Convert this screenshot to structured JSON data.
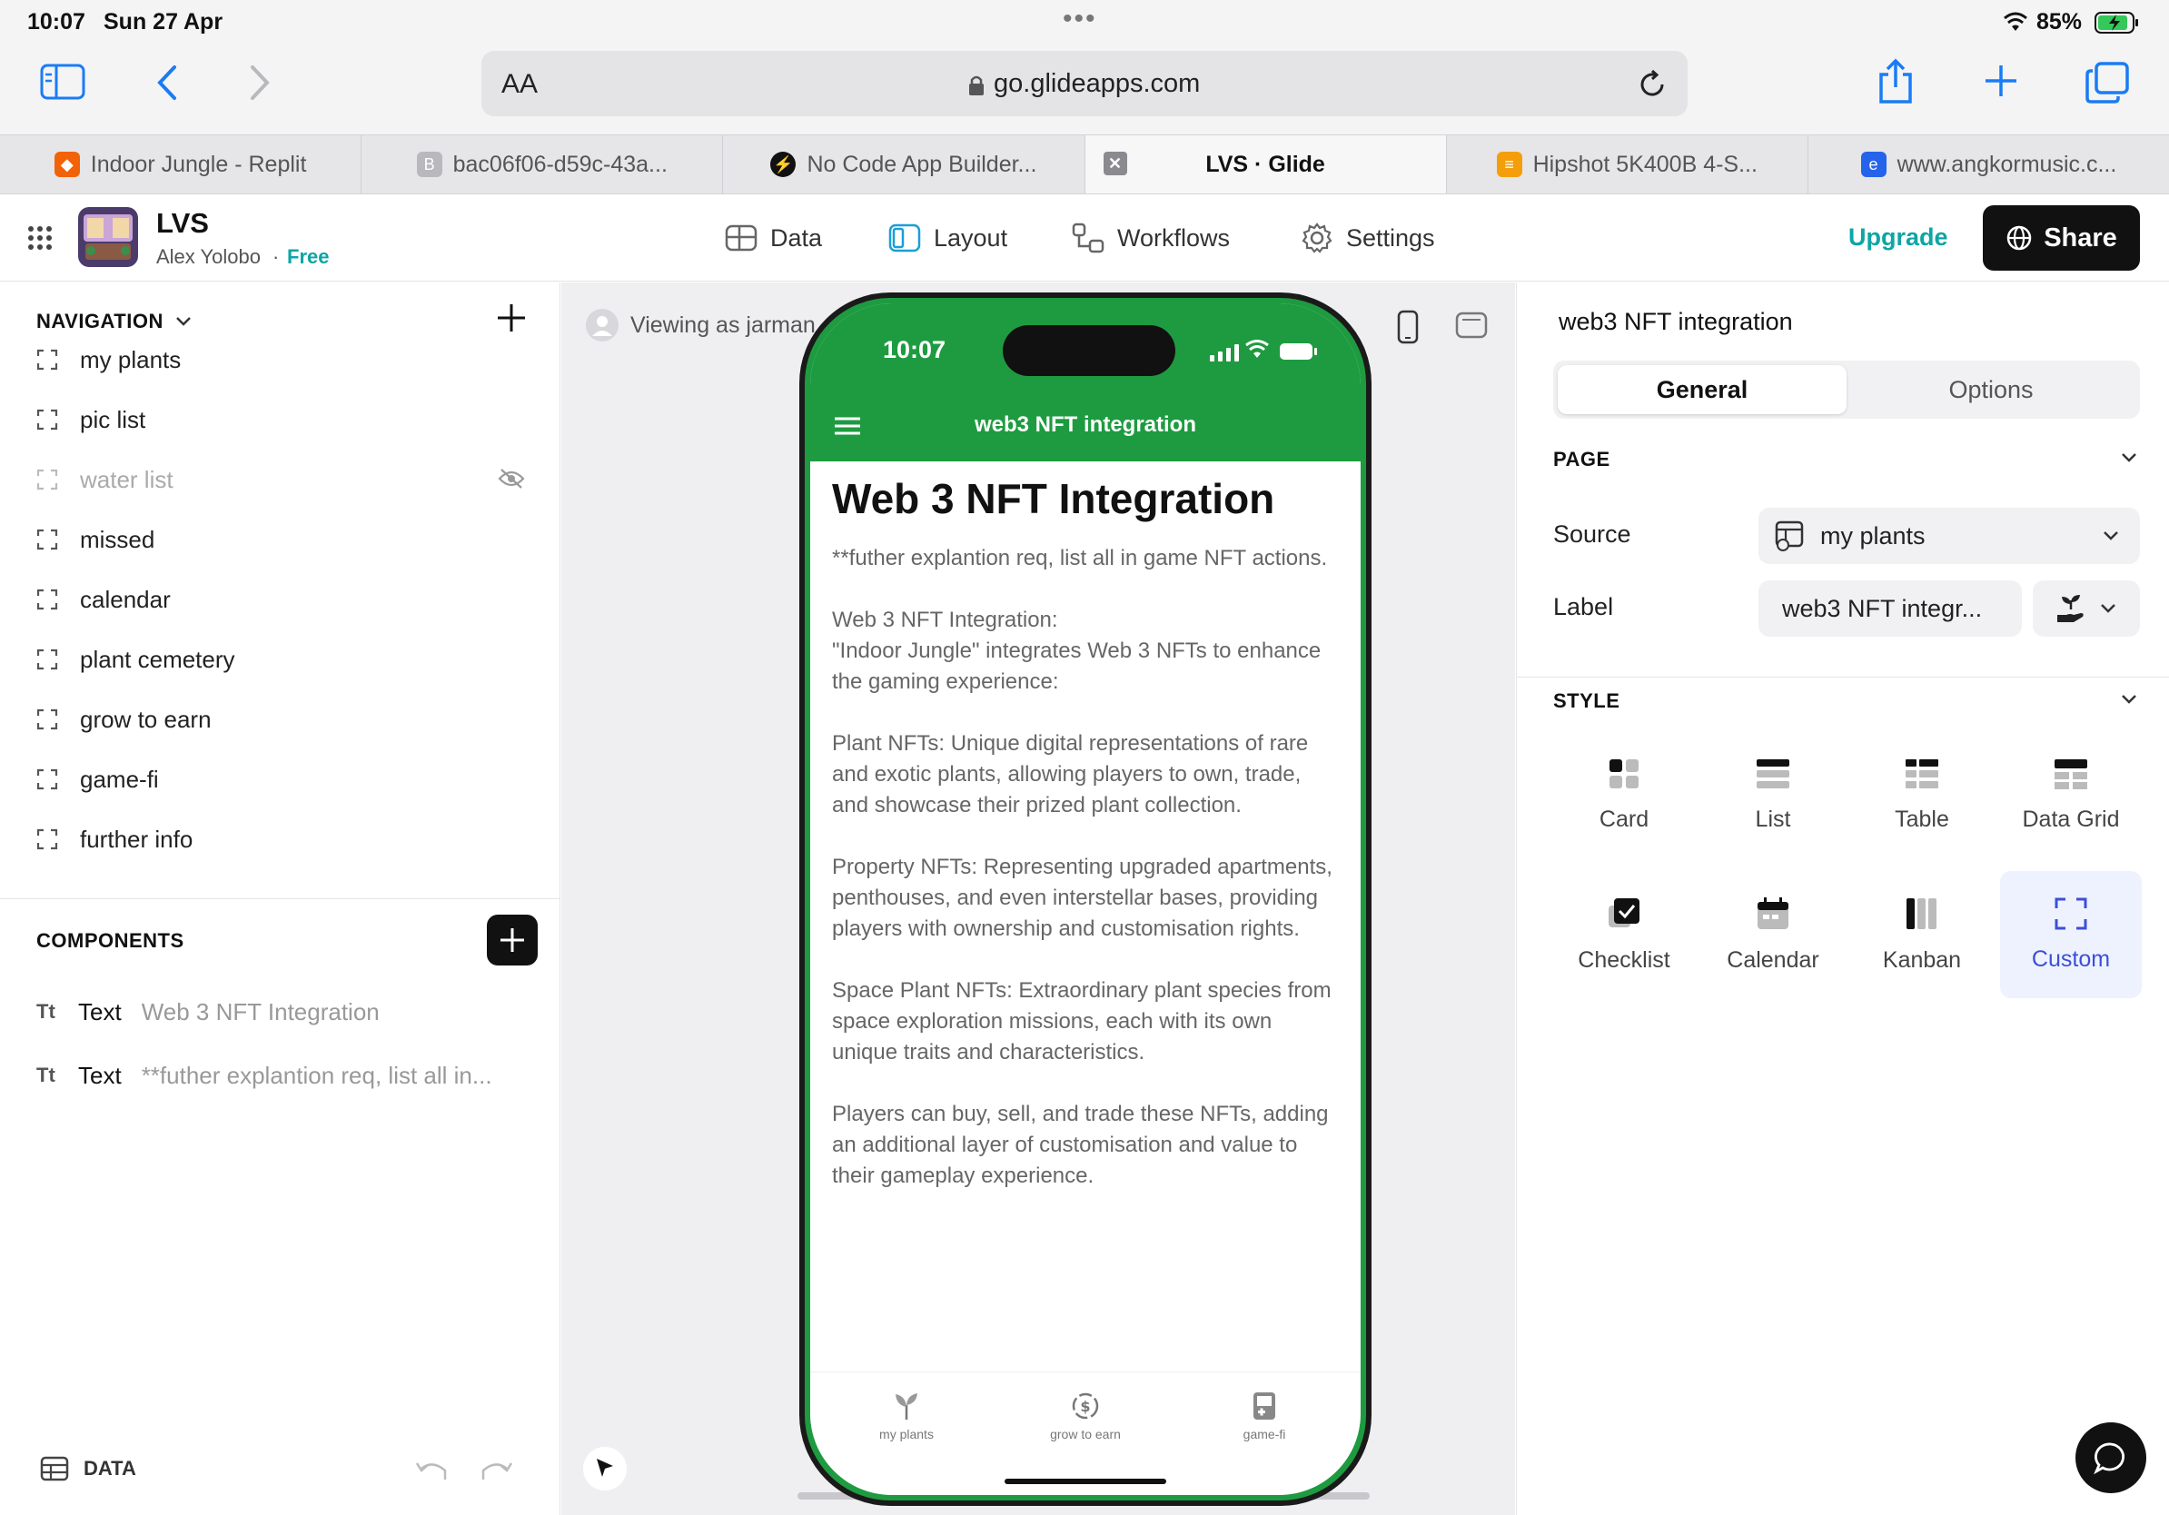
{
  "status": {
    "time": "10:07",
    "date": "Sun 27 Apr",
    "battery": "85%"
  },
  "browser": {
    "aa": "AA",
    "url": "go.glideapps.com"
  },
  "tabs": [
    {
      "label": "Indoor Jungle - Replit",
      "color": "#f26207",
      "glyph": "◆"
    },
    {
      "label": "bac06f06-d59c-43a...",
      "color": "#b8b8bd",
      "glyph": "B"
    },
    {
      "label": "No Code App Builder...",
      "color": "#111111",
      "glyph": "⚡"
    },
    {
      "label": "LVS · Glide",
      "color": "",
      "glyph": ""
    },
    {
      "label": "Hipshot 5K400B 4-S...",
      "color": "#f59e0b",
      "glyph": "≡"
    },
    {
      "label": "www.angkormusic.c...",
      "color": "#2563eb",
      "glyph": "e"
    }
  ],
  "app": {
    "name": "LVS",
    "user": "Alex Yolobo",
    "separator": "·",
    "plan": "Free",
    "nav": {
      "data": "Data",
      "layout": "Layout",
      "workflows": "Workflows",
      "settings": "Settings"
    },
    "upgrade": "Upgrade",
    "share": "Share"
  },
  "left": {
    "navigation_title": "NAVIGATION",
    "nav_items": [
      {
        "label": "my plants"
      },
      {
        "label": "pic list"
      },
      {
        "label": "water list"
      },
      {
        "label": "missed"
      },
      {
        "label": "calendar"
      },
      {
        "label": "plant cemetery"
      },
      {
        "label": "grow to earn"
      },
      {
        "label": "game-fi"
      },
      {
        "label": "further info"
      }
    ],
    "components_title": "COMPONENTS",
    "components": [
      {
        "icon": "Tt",
        "type": "Text",
        "value": "Web 3 NFT Integration"
      },
      {
        "icon": "Tt",
        "type": "Text",
        "value": "**futher explantion req, list all in..."
      }
    ],
    "data_label": "DATA"
  },
  "canvas": {
    "viewing": "Viewing as jarman"
  },
  "phone": {
    "time": "10:07",
    "title": "web3 NFT integration",
    "heading": "Web 3 NFT Integration",
    "paragraphs": [
      "**futher explantion req, list all in game NFT actions.",
      "Web 3 NFT Integration:\n\"Indoor Jungle\" integrates Web 3 NFTs to enhance the gaming experience:",
      "Plant NFTs: Unique digital representations of rare and exotic plants, allowing players to own, trade, and showcase their prized plant collection.",
      "Property NFTs: Representing upgraded apartments, penthouses, and even interstellar bases, providing players with ownership and customisation rights.",
      "Space Plant NFTs: Extraordinary plant species from space exploration missions, each with its own unique traits and characteristics.",
      "Players can buy, sell, and trade these NFTs, adding an additional layer of customisation and value to their gameplay experience."
    ],
    "tabs": [
      "my plants",
      "grow to earn",
      "game-fi"
    ]
  },
  "right": {
    "title": "web3 NFT integration",
    "seg": {
      "general": "General",
      "options": "Options"
    },
    "page_title": "PAGE",
    "source_label": "Source",
    "source_value": "my plants",
    "label_label": "Label",
    "label_value": "web3 NFT integr...",
    "style_title": "STYLE",
    "styles": [
      "Card",
      "List",
      "Table",
      "Data Grid",
      "Checklist",
      "Calendar",
      "Kanban",
      "Custom"
    ]
  },
  "colors": {
    "accent": "#0ea5a5",
    "phone_green": "#1e9b40",
    "selected": "#3b4fd6"
  }
}
